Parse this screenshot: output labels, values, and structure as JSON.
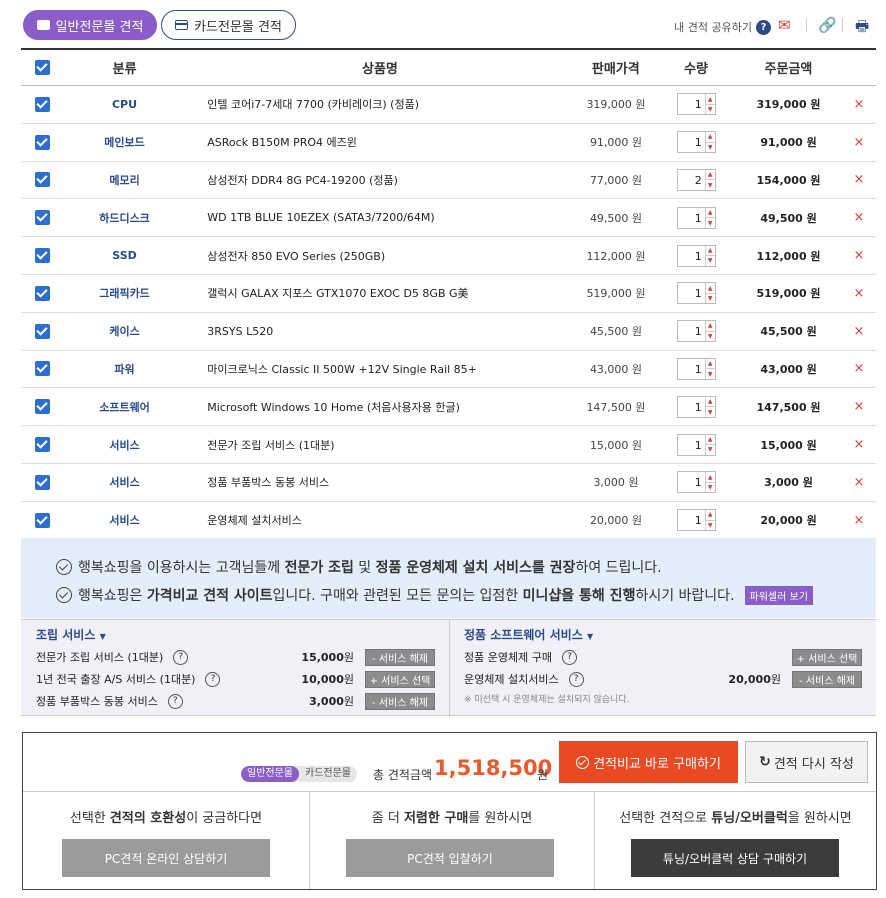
{
  "tabs": {
    "general": "일반전문몰 견적",
    "card": "카드전문몰 견적"
  },
  "share": {
    "label": "내 견적 공유하기",
    "help": "?"
  },
  "icons": {
    "mail": "mail-icon",
    "link": "link-icon",
    "print": "print-icon"
  },
  "table": {
    "headers": {
      "category": "분류",
      "name": "상품명",
      "price": "판매가격",
      "qty": "수량",
      "total": "주문금액"
    },
    "rows": [
      {
        "category": "CPU",
        "name": "인텔 코어i7-7세대 7700 (카비레이크) (정품)",
        "price": "319,000 원",
        "qty": "1",
        "total": "319,000 원"
      },
      {
        "category": "메인보드",
        "name": "ASRock B150M PRO4 에즈윈",
        "price": "91,000 원",
        "qty": "1",
        "total": "91,000 원"
      },
      {
        "category": "메모리",
        "name": "삼성전자 DDR4 8G PC4-19200 (정품)",
        "price": "77,000 원",
        "qty": "2",
        "total": "154,000 원"
      },
      {
        "category": "하드디스크",
        "name": "WD 1TB BLUE 10EZEX (SATA3/7200/64M)",
        "price": "49,500 원",
        "qty": "1",
        "total": "49,500 원"
      },
      {
        "category": "SSD",
        "name": "삼성전자 850 EVO Series (250GB)",
        "price": "112,000 원",
        "qty": "1",
        "total": "112,000 원"
      },
      {
        "category": "그래픽카드",
        "name": "갤럭시 GALAX 지포스 GTX1070 EXOC D5 8GB G美",
        "price": "519,000 원",
        "qty": "1",
        "total": "519,000 원"
      },
      {
        "category": "케이스",
        "name": "3RSYS L520",
        "price": "45,500 원",
        "qty": "1",
        "total": "45,500 원"
      },
      {
        "category": "파워",
        "name": "마이크로닉스 Classic II 500W +12V Single Rail 85+",
        "price": "43,000 원",
        "qty": "1",
        "total": "43,000 원"
      },
      {
        "category": "소프트웨어",
        "name": "Microsoft Windows 10 Home (처음사용자용 한글)",
        "price": "147,500 원",
        "qty": "1",
        "total": "147,500 원"
      },
      {
        "category": "서비스",
        "name": "전문가 조립 서비스 (1대분)",
        "price": "15,000 원",
        "qty": "1",
        "total": "15,000 원"
      },
      {
        "category": "서비스",
        "name": "정품 부품박스 동봉 서비스",
        "price": "3,000 원",
        "qty": "1",
        "total": "3,000 원"
      },
      {
        "category": "서비스",
        "name": "운영체제 설치서비스",
        "price": "20,000 원",
        "qty": "1",
        "total": "20,000 원"
      }
    ],
    "delete_symbol": "×"
  },
  "notice": {
    "line1": {
      "a": "행복쇼핑을 이용하시는 고객님들께 ",
      "b": "전문가 조립",
      "c": " 및 ",
      "d": "정품 운영체제 설치 서비스를 권장",
      "e": "하여 드립니다."
    },
    "line2": {
      "a": "행복쇼핑은 ",
      "b": "가격비교 견적 사이트",
      "c": "입니다. 구매와 관련된 모든 문의는 입점한 ",
      "d": "미니샵을 통해 진행",
      "e": "하시기 바랍니다."
    },
    "seller_button": "파워셀러 보기"
  },
  "services": {
    "assembly": {
      "title": "조립 서비스",
      "items": [
        {
          "label": "전문가 조립 서비스 (1대분)",
          "price": "15,000",
          "unit": "원",
          "button": "- 서비스 해제"
        },
        {
          "label": "1년 전국 출장 A/S 서비스 (1대분)",
          "price": "10,000",
          "unit": "원",
          "button": "+ 서비스 선택"
        },
        {
          "label": "정품 부품박스 동봉 서비스",
          "price": "3,000",
          "unit": "원",
          "button": "- 서비스 해제"
        }
      ]
    },
    "software": {
      "title": "정품 소프트웨어 서비스",
      "items": [
        {
          "label": "정품 운영체제 구매",
          "price": "",
          "unit": "",
          "button": "+ 서비스 선택"
        },
        {
          "label": "운영체제 설치서비스",
          "price": "20,000",
          "unit": "원",
          "button": "- 서비스 해제"
        }
      ],
      "note": "※ 미선택 시 운영체제는 설치되지 않습니다."
    }
  },
  "summary": {
    "mode_active": "일반전문몰",
    "mode_inactive": "카드전문몰",
    "total_label": "총 견적금액",
    "total_value": "1,518,500",
    "total_unit": "원",
    "buy_button": "견적비교 바로 구매하기",
    "redo_button": "견적 다시 작성"
  },
  "cta": [
    {
      "pre": "선택한 ",
      "bold": "견적의 호환성",
      "post": "이 궁금하다면",
      "button": "PC견적 온라인 상담하기"
    },
    {
      "pre": "좀 더 ",
      "bold": "저렴한 구매",
      "post": "를 원하시면",
      "button": "PC견적 입찰하기"
    },
    {
      "pre": "선택한 견적으로 ",
      "bold": "튜닝/오버클럭",
      "post": "을 원하시면",
      "button": "튜닝/오버클럭 상담 구매하기"
    }
  ],
  "colors": {
    "accent_purple": "#8a5dc9",
    "navy": "#2a4c8f",
    "check_blue": "#2c6fd1",
    "total_orange": "#e85a2b",
    "buy_red": "#e84a24"
  }
}
